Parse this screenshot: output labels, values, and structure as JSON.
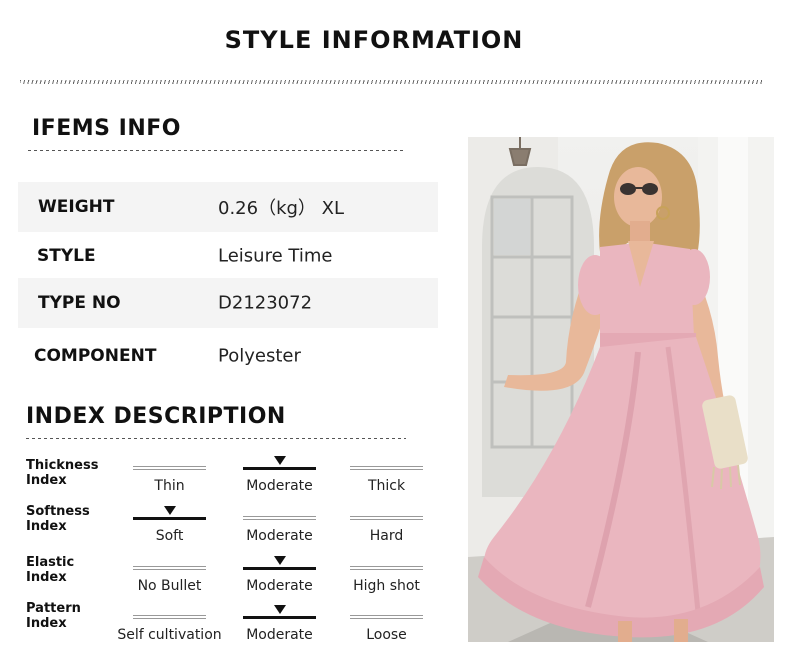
{
  "header": {
    "title": "STYLE INFORMATION"
  },
  "items_info": {
    "heading": "IFEMS INFO",
    "rows": [
      {
        "label": "WEIGHT",
        "value": "0.26（kg） XL"
      },
      {
        "label": "STYLE",
        "value": "Leisure Time"
      },
      {
        "label": "TYPE NO",
        "value": "D2123072"
      },
      {
        "label": "COMPONENT",
        "value": "Polyester"
      }
    ]
  },
  "index_description": {
    "heading": "INDEX DESCRIPTION",
    "indices": [
      {
        "label_line1": "Thickness",
        "label_line2": "Index",
        "options": [
          "Thin",
          "Moderate",
          "Thick"
        ],
        "selected": "Moderate"
      },
      {
        "label_line1": "Softness",
        "label_line2": "Index",
        "options": [
          "Soft",
          "Moderate",
          "Hard"
        ],
        "selected": "Soft"
      },
      {
        "label_line1": "Elastic",
        "label_line2": "Index",
        "options": [
          "No Bullet",
          "Moderate",
          "High shot"
        ],
        "selected": "Moderate"
      },
      {
        "label_line1": "Pattern",
        "label_line2": "Index",
        "options": [
          "Self cultivation",
          "Moderate",
          "Loose"
        ],
        "selected": "Moderate"
      }
    ]
  },
  "photo": {
    "subject": "woman-in-pink-floral-midi-dress",
    "colors": {
      "dress": "#eab6bf",
      "dress_shadow": "#d99aa7",
      "hair": "#c9a06a",
      "skin": "#e8b89a"
    }
  }
}
